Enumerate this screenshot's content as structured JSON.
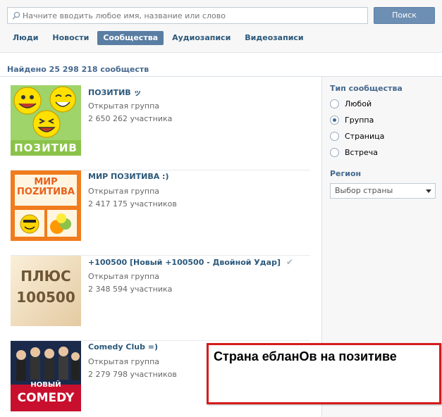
{
  "search": {
    "placeholder": "Начните вводить любое имя, название или слово",
    "value": "",
    "button_label": "Поиск"
  },
  "tabs": [
    {
      "label": "Люди",
      "active": false
    },
    {
      "label": "Новости",
      "active": false
    },
    {
      "label": "Сообщества",
      "active": true
    },
    {
      "label": "Аудиозаписи",
      "active": false
    },
    {
      "label": "Видеозаписи",
      "active": false
    }
  ],
  "results": {
    "summary": "Найдено 25 298 218 сообществ",
    "items": [
      {
        "name": "ПОЗИТИВ ッ",
        "type": "Открытая группа",
        "members": "2 650 262 участника",
        "thumb_text": "ПОЗИТИВ"
      },
      {
        "name": "МИР ПОЗИТИВА :)",
        "type": "Открытая группа",
        "members": "2 417 175 участников",
        "thumb_text": [
          "МИР",
          "ПОZИТИВА"
        ]
      },
      {
        "name": "+100500 [Новый +100500 - Двойной Удар]",
        "type": "Открытая группа",
        "members": "2 348 594 участника",
        "thumb_text": [
          "ПЛЮС",
          "100500"
        ],
        "verified": true
      },
      {
        "name": "Comedy Club =)",
        "type": "Открытая группа",
        "members": "2 279 798 участников",
        "thumb_text": [
          "НОВЫЙ",
          "COMEDY"
        ]
      }
    ]
  },
  "filters": {
    "type_title": "Тип сообщества",
    "type_options": [
      {
        "label": "Любой",
        "checked": false
      },
      {
        "label": "Группа",
        "checked": true
      },
      {
        "label": "Страница",
        "checked": false
      },
      {
        "label": "Встреча",
        "checked": false
      }
    ],
    "region_title": "Регион",
    "region_select": "Выбор страны"
  },
  "annotation": {
    "text": "Страна ебланОв на позитиве",
    "border_color": "#d51b1b"
  },
  "colors": {
    "link": "#2b587a",
    "header": "#45688e",
    "accent": "#597da3"
  }
}
